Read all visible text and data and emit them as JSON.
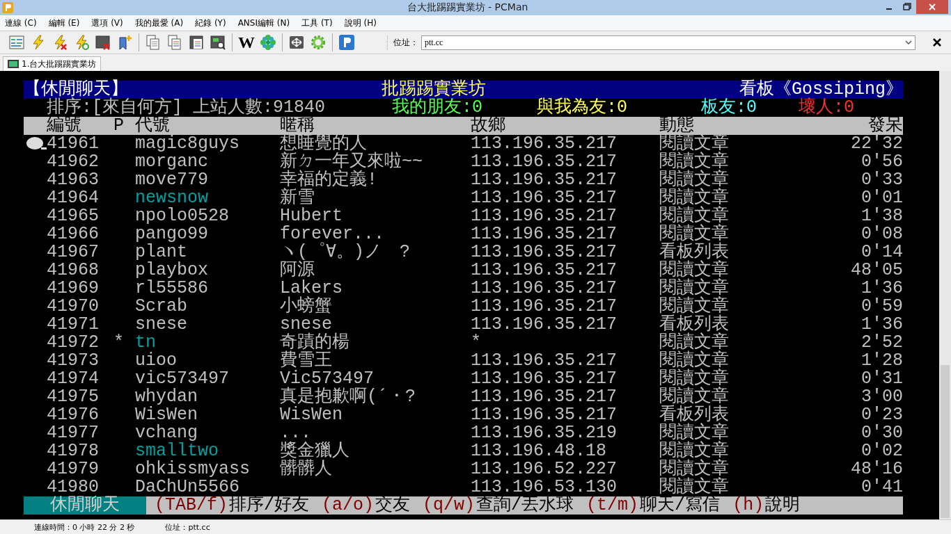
{
  "window": {
    "title": "台大批踢踢實業坊 - PCMan"
  },
  "menu": [
    {
      "label": "連線 (C)"
    },
    {
      "label": "編輯 (E)"
    },
    {
      "label": "選項 (V)"
    },
    {
      "label": "我的最愛 (A)"
    },
    {
      "label": "紀錄 (Y)"
    },
    {
      "label": "ANSI編輯 (N)"
    },
    {
      "label": "工具 (T)"
    },
    {
      "label": "說明 (H)"
    }
  ],
  "toolbar": {
    "wiki_button": "W",
    "address_label": "位址：",
    "address_value": "ptt.cc"
  },
  "tabs": [
    {
      "label": "1.台大批踢踢實業坊",
      "selected": true
    }
  ],
  "terminal": {
    "board_category": "【休閒聊天】",
    "site_name": "批踢踢實業坊",
    "board_name": "看板《Gossiping》",
    "sort_info": "排序:[來自何方] 上站人數:91840",
    "my_friends": "我的朋友:0",
    "friend_of": "與我為友:0",
    "board_friends": "板友:0",
    "bad_guys": "壞人:0",
    "columns": [
      "編號",
      "P",
      "代號",
      "暱稱",
      "故鄉",
      "動態",
      "發呆"
    ],
    "rows": [
      {
        "num": "41961",
        "p": "",
        "id": "magic8guys",
        "nick": "想睡覺的人",
        "from": "113.196.35.217",
        "status": "閱讀文章",
        "idle": "22'32",
        "friend": false,
        "cursor": true
      },
      {
        "num": "41962",
        "p": "",
        "id": "morganc",
        "nick": "新ㄉ一年又來啦~~",
        "from": "113.196.35.217",
        "status": "閱讀文章",
        "idle": "0'56",
        "friend": false,
        "cursor": false
      },
      {
        "num": "41963",
        "p": "",
        "id": "move779",
        "nick": "幸福的定義!",
        "from": "113.196.35.217",
        "status": "閱讀文章",
        "idle": "0'33",
        "friend": false,
        "cursor": false
      },
      {
        "num": "41964",
        "p": "",
        "id": "newsnow",
        "nick": "新雪",
        "from": "113.196.35.217",
        "status": "閱讀文章",
        "idle": "0'01",
        "friend": true,
        "cursor": false
      },
      {
        "num": "41965",
        "p": "",
        "id": "npolo0528",
        "nick": "Hubert",
        "from": "113.196.35.217",
        "status": "閱讀文章",
        "idle": "1'38",
        "friend": false,
        "cursor": false
      },
      {
        "num": "41966",
        "p": "",
        "id": "pango99",
        "nick": "forever...",
        "from": "113.196.35.217",
        "status": "閱讀文章",
        "idle": "0'08",
        "friend": false,
        "cursor": false
      },
      {
        "num": "41967",
        "p": "",
        "id": "plant",
        "nick": "ヽ(゜∀。)ノ　?",
        "from": "113.196.35.217",
        "status": "看板列表",
        "idle": "0'14",
        "friend": false,
        "cursor": false
      },
      {
        "num": "41968",
        "p": "",
        "id": "playbox",
        "nick": "阿源",
        "from": "113.196.35.217",
        "status": "閱讀文章",
        "idle": "48'05",
        "friend": false,
        "cursor": false
      },
      {
        "num": "41969",
        "p": "",
        "id": "rl55586",
        "nick": "Lakers",
        "from": "113.196.35.217",
        "status": "閱讀文章",
        "idle": "1'36",
        "friend": false,
        "cursor": false
      },
      {
        "num": "41970",
        "p": "",
        "id": "Scrab",
        "nick": "小螃蟹",
        "from": "113.196.35.217",
        "status": "閱讀文章",
        "idle": "0'59",
        "friend": false,
        "cursor": false
      },
      {
        "num": "41971",
        "p": "",
        "id": "snese",
        "nick": "snese",
        "from": "113.196.35.217",
        "status": "看板列表",
        "idle": "1'36",
        "friend": false,
        "cursor": false
      },
      {
        "num": "41972",
        "p": "*",
        "id": "tn",
        "nick": "奇蹟的楊",
        "from": "*",
        "status": "閱讀文章",
        "idle": "2'52",
        "friend": true,
        "cursor": false
      },
      {
        "num": "41973",
        "p": "",
        "id": "uioo",
        "nick": "費雪王",
        "from": "113.196.35.217",
        "status": "閱讀文章",
        "idle": "1'28",
        "friend": false,
        "cursor": false
      },
      {
        "num": "41974",
        "p": "",
        "id": "vic573497",
        "nick": "Vic573497",
        "from": "113.196.35.217",
        "status": "閱讀文章",
        "idle": "0'31",
        "friend": false,
        "cursor": false
      },
      {
        "num": "41975",
        "p": "",
        "id": "whydan",
        "nick": "真是抱歉啊(´・?",
        "from": "113.196.35.217",
        "status": "閱讀文章",
        "idle": "3'00",
        "friend": false,
        "cursor": false
      },
      {
        "num": "41976",
        "p": "",
        "id": "WisWen",
        "nick": "WisWen",
        "from": "113.196.35.217",
        "status": "看板列表",
        "idle": "0'23",
        "friend": false,
        "cursor": false
      },
      {
        "num": "41977",
        "p": "",
        "id": "vchang",
        "nick": "...",
        "from": "113.196.35.219",
        "status": "閱讀文章",
        "idle": "0'30",
        "friend": false,
        "cursor": false
      },
      {
        "num": "41978",
        "p": "",
        "id": "smalltwo",
        "nick": "獎金獵人",
        "from": "113.196.48.18",
        "status": "閱讀文章",
        "idle": "0'02",
        "friend": true,
        "cursor": false
      },
      {
        "num": "41979",
        "p": "",
        "id": "ohkissmyass",
        "nick": "髒髒人",
        "from": "113.196.52.227",
        "status": "閱讀文章",
        "idle": "48'16",
        "friend": false,
        "cursor": false
      },
      {
        "num": "41980",
        "p": "",
        "id": "DaChUn5566",
        "nick": "",
        "from": "113.196.53.130",
        "status": "閱讀文章",
        "idle": "0'41",
        "friend": false,
        "cursor": false
      }
    ],
    "footer_mode": "休閒聊天",
    "footer_hints": [
      {
        "key": "(TAB/f)",
        "label": "排序/好友"
      },
      {
        "key": "(a/o)",
        "label": "交友"
      },
      {
        "key": "(q/w)",
        "label": "查詢/丟水球"
      },
      {
        "key": "(t/m)",
        "label": "聊天/寫信"
      },
      {
        "key": "(h)",
        "label": "說明"
      }
    ]
  },
  "status_bar": {
    "connection_time": "連線時間：0 小時 22 分 2 秒",
    "address": "位址：ptt.cc"
  }
}
